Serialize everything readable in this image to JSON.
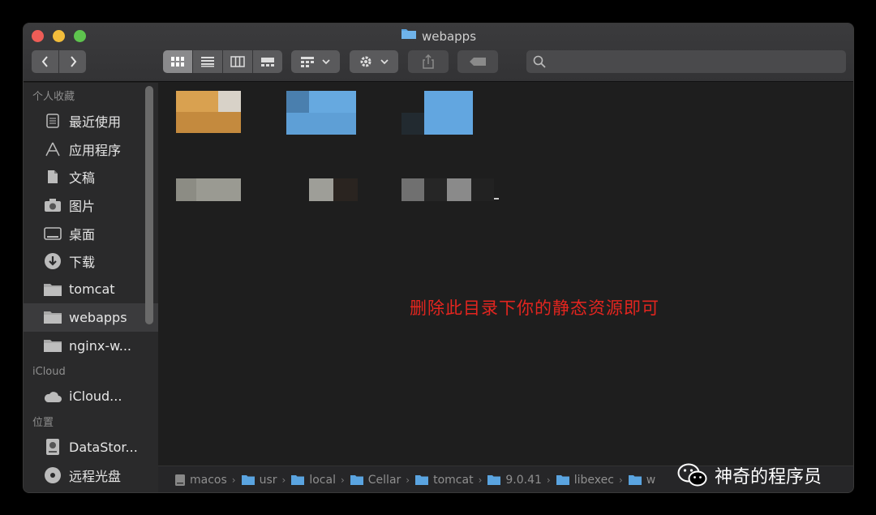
{
  "window": {
    "title": "webapps"
  },
  "toolbar": {
    "search_placeholder": ""
  },
  "sidebar": {
    "sections": [
      {
        "title": "个人收藏",
        "items": [
          {
            "label": "最近使用",
            "icon": "recent-icon"
          },
          {
            "label": "应用程序",
            "icon": "applications-icon"
          },
          {
            "label": "文稿",
            "icon": "documents-icon"
          },
          {
            "label": "图片",
            "icon": "pictures-icon"
          },
          {
            "label": "桌面",
            "icon": "desktop-icon"
          },
          {
            "label": "下载",
            "icon": "downloads-icon"
          },
          {
            "label": "tomcat",
            "icon": "folder-icon"
          },
          {
            "label": "webapps",
            "icon": "folder-icon",
            "selected": true
          },
          {
            "label": "nginx-w...",
            "icon": "folder-icon"
          }
        ]
      },
      {
        "title": "iCloud",
        "items": [
          {
            "label": "iCloud...",
            "icon": "cloud-icon"
          }
        ]
      },
      {
        "title": "位置",
        "items": [
          {
            "label": "DataStor...",
            "icon": "disk-icon"
          },
          {
            "label": "远程光盘",
            "icon": "remote-disc-icon"
          }
        ]
      }
    ]
  },
  "annotation": {
    "text": "删除此目录下你的静态资源即可",
    "color": "#e3251f"
  },
  "pathbar": {
    "crumbs": [
      "macos",
      "usr",
      "local",
      "Cellar",
      "tomcat",
      "9.0.41",
      "libexec",
      "w"
    ]
  },
  "watermark": {
    "text": "神奇的程序员"
  },
  "colors": {
    "folder_blue": "#5aa4e0",
    "sidebar_bg": "#2a2a2b",
    "content_bg": "#1e1e1e"
  }
}
